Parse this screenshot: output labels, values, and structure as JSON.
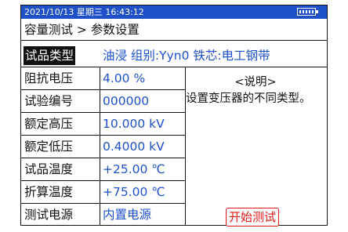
{
  "status": {
    "datetime": "2021/10/13 星期三 16:43:12",
    "battery_icon": "battery-icon"
  },
  "breadcrumb": {
    "text": "容量测试 > 参数设置"
  },
  "params": {
    "sample_type": {
      "label": "试品类型",
      "value": "油浸 组别:Yyn0 铁芯:电工钢带"
    },
    "impedance": {
      "label": "阻抗电压",
      "value": "4.00 %"
    },
    "test_no": {
      "label": "试验编号",
      "value": "000000"
    },
    "rated_high": {
      "label": "额定高压",
      "value": "10.000 kV"
    },
    "rated_low": {
      "label": "额定低压",
      "value": "0.4000 kV"
    },
    "sample_temp": {
      "label": "试品温度",
      "value": "+25.00 ℃"
    },
    "conv_temp": {
      "label": "折算温度",
      "value": "+75.00 ℃"
    },
    "power": {
      "label": "测试电源",
      "value": "内置电源"
    }
  },
  "info": {
    "title": "<说明>",
    "text": "设置变压器的不同类型。"
  },
  "start_button": {
    "label": "开始测试"
  },
  "colors": {
    "header": "#1e50c8",
    "value": "#1e50c8",
    "button": "#e01818"
  }
}
